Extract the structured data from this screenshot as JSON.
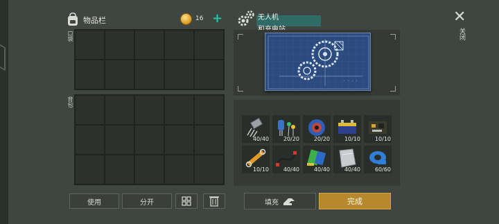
{
  "inventory": {
    "title": "物品栏",
    "coins": "16",
    "add_symbol": "+",
    "section_pocket": "口袋",
    "section_backpack": "背包",
    "pocket_cells": 10,
    "backpack_cells": 15
  },
  "actions": {
    "use_label": "使用",
    "split_label": "分开"
  },
  "blueprint": {
    "name_line1": "无人机",
    "name_line2": "和充电站"
  },
  "materials": [
    {
      "icon": "transistor-icon",
      "count": "40/40"
    },
    {
      "icon": "capacitor-icon",
      "count": "20/20"
    },
    {
      "icon": "wire-spool-icon",
      "count": "20/20"
    },
    {
      "icon": "battery-icon",
      "count": "10/10"
    },
    {
      "icon": "circuit-board-icon",
      "count": "10/10"
    },
    {
      "icon": "hydraulic-cylinder-icon",
      "count": "10/10"
    },
    {
      "icon": "cable-icon",
      "count": "40/40"
    },
    {
      "icon": "solar-panel-icon",
      "count": "40/40"
    },
    {
      "icon": "metal-sheet-icon",
      "count": "40/40"
    },
    {
      "icon": "duct-tape-icon",
      "count": "60/60"
    }
  ],
  "footer": {
    "fill_label": "填充",
    "done_label": "完成"
  },
  "close": {
    "symbol": "✕",
    "label": "关闭"
  }
}
